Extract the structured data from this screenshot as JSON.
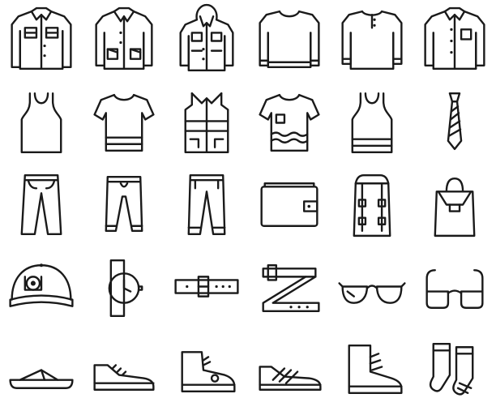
{
  "icon_set": {
    "stroke_color": "#1a1a1a",
    "background": "#ffffff",
    "rows": [
      [
        "denim-jacket-icon",
        "field-jacket-icon",
        "hooded-coat-icon",
        "sweater-icon",
        "henley-shirt-icon",
        "pocket-shirt-icon"
      ],
      [
        "tank-top-icon",
        "striped-tshirt-icon",
        "puffer-vest-icon",
        "pocket-tshirt-icon",
        "striped-tank-icon",
        "necktie-icon"
      ],
      [
        "jeans-icon",
        "jogger-pants-icon",
        "trousers-icon",
        "wallet-icon",
        "backpack-straps-icon",
        "backpack-icon"
      ],
      [
        "baseball-cap-icon",
        "wristwatch-icon",
        "belt-icon",
        "folded-belt-icon",
        "aviator-sunglasses-icon",
        "eyeglasses-icon"
      ],
      [
        "flip-flop-icon",
        "sneaker-icon",
        "high-top-sneaker-icon",
        "running-shoe-icon",
        "hiking-boot-icon",
        "socks-icon"
      ]
    ]
  }
}
